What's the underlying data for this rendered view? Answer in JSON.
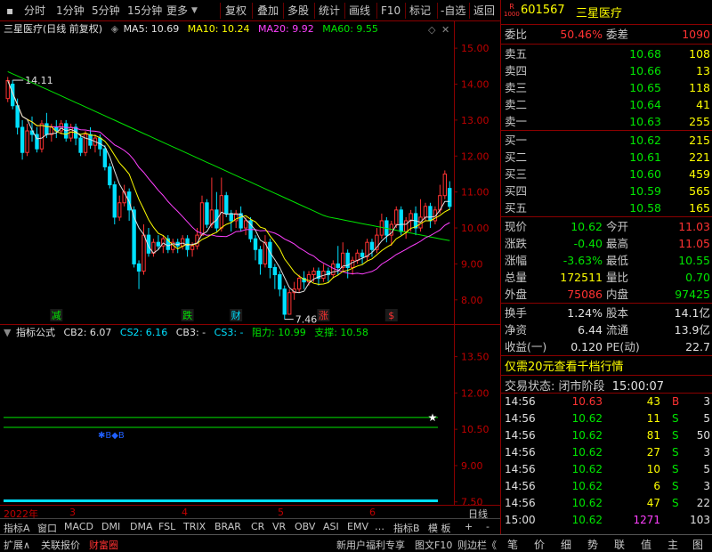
{
  "toolbar": {
    "period_buttons": [
      "分时",
      "1分钟",
      "5分钟",
      "15分钟",
      "更多"
    ],
    "action_buttons": [
      "复权",
      "叠加",
      "多股",
      "统计",
      "画线",
      "F10",
      "标记",
      "-自选",
      "返回"
    ]
  },
  "chart_title": {
    "name": "三星医疗",
    "mode": "(日线 前复权)",
    "ma5": "MA5: 10.69",
    "ma10": "MA10: 10.24",
    "ma20": "MA20: 9.92",
    "ma60": "MA60: 9.55"
  },
  "colors": {
    "up": "#ff3232",
    "down": "#00e0ff",
    "ma5": "#e0e0e0",
    "ma10": "#ffff00",
    "ma20": "#ff40ff",
    "ma60": "#00e600",
    "grid": "#8b0000"
  },
  "chart_data": {
    "type": "candlestick",
    "ylim": [
      7.5,
      15.3
    ],
    "yticks": [
      "15.00",
      "14.00",
      "13.00",
      "12.00",
      "11.00",
      "10.00",
      "9.00",
      "8.00"
    ],
    "high_label": "14.11",
    "low_label": "7.46",
    "candles": [
      [
        13.6,
        14.1,
        14.2,
        13.5
      ],
      [
        14.0,
        13.4,
        14.11,
        13.3
      ],
      [
        13.4,
        12.8,
        13.6,
        12.6
      ],
      [
        12.8,
        12.1,
        13.0,
        11.9
      ],
      [
        12.1,
        12.7,
        12.9,
        12.0
      ],
      [
        12.7,
        12.6,
        13.1,
        12.4
      ],
      [
        12.6,
        12.2,
        12.8,
        12.1
      ],
      [
        12.2,
        12.9,
        13.0,
        12.1
      ],
      [
        12.9,
        12.6,
        13.2,
        12.5
      ],
      [
        12.6,
        12.8,
        12.9,
        12.4
      ],
      [
        12.8,
        12.7,
        13.0,
        12.5
      ],
      [
        12.7,
        12.9,
        13.0,
        12.6
      ],
      [
        12.9,
        12.5,
        13.0,
        12.4
      ],
      [
        12.5,
        12.8,
        12.9,
        12.4
      ],
      [
        12.8,
        12.5,
        12.9,
        12.3
      ],
      [
        12.5,
        12.1,
        12.6,
        12.0
      ],
      [
        12.1,
        12.6,
        12.7,
        12.0
      ],
      [
        12.6,
        12.3,
        12.8,
        12.2
      ],
      [
        12.3,
        12.5,
        12.6,
        12.1
      ],
      [
        12.5,
        12.2,
        12.6,
        12.0
      ],
      [
        12.2,
        11.7,
        12.3,
        11.6
      ],
      [
        11.7,
        11.2,
        11.8,
        11.1
      ],
      [
        11.2,
        10.3,
        11.3,
        10.1
      ],
      [
        10.3,
        10.7,
        10.9,
        10.2
      ],
      [
        10.7,
        11.0,
        11.2,
        10.6
      ],
      [
        11.0,
        10.5,
        11.1,
        10.2
      ],
      [
        10.5,
        9.0,
        10.6,
        8.9
      ],
      [
        9.0,
        8.8,
        9.1,
        8.3
      ],
      [
        8.8,
        9.8,
        10.1,
        8.7
      ],
      [
        9.8,
        9.3,
        10.0,
        9.2
      ],
      [
        9.3,
        9.6,
        9.7,
        9.2
      ],
      [
        9.6,
        9.5,
        9.8,
        9.4
      ],
      [
        9.5,
        9.7,
        9.8,
        9.3
      ],
      [
        9.7,
        9.4,
        9.8,
        9.3
      ],
      [
        9.4,
        9.6,
        9.7,
        9.3
      ],
      [
        9.6,
        9.5,
        9.7,
        9.3
      ],
      [
        9.5,
        9.7,
        9.8,
        9.4
      ],
      [
        9.7,
        9.4,
        9.8,
        9.2
      ],
      [
        9.4,
        9.5,
        9.6,
        9.2
      ],
      [
        9.5,
        9.8,
        10.0,
        9.4
      ],
      [
        9.8,
        10.7,
        10.9,
        9.8
      ],
      [
        10.7,
        10.1,
        10.8,
        10.0
      ],
      [
        10.1,
        10.5,
        11.4,
        10.0
      ],
      [
        10.5,
        10.0,
        11.0,
        9.9
      ],
      [
        10.0,
        10.9,
        11.4,
        9.9
      ],
      [
        10.9,
        10.4,
        11.0,
        10.3
      ],
      [
        10.4,
        10.2,
        10.5,
        9.9
      ],
      [
        10.2,
        10.4,
        10.5,
        10.0
      ],
      [
        10.4,
        10.0,
        10.6,
        9.9
      ],
      [
        10.0,
        10.2,
        10.3,
        9.8
      ],
      [
        10.2,
        9.7,
        10.3,
        9.6
      ],
      [
        9.7,
        9.4,
        9.8,
        9.1
      ],
      [
        9.4,
        9.0,
        9.5,
        8.7
      ],
      [
        9.0,
        9.6,
        9.8,
        8.9
      ],
      [
        9.6,
        8.9,
        9.7,
        8.6
      ],
      [
        8.9,
        8.7,
        9.0,
        8.3
      ],
      [
        8.7,
        8.3,
        8.8,
        8.1
      ],
      [
        8.3,
        7.6,
        8.4,
        7.46
      ],
      [
        7.6,
        8.2,
        8.3,
        7.6
      ],
      [
        8.2,
        8.3,
        8.5,
        8.0
      ],
      [
        8.3,
        8.6,
        8.7,
        8.2
      ],
      [
        8.6,
        8.5,
        8.8,
        8.3
      ],
      [
        8.5,
        8.7,
        8.8,
        8.4
      ],
      [
        8.7,
        8.8,
        8.9,
        8.5
      ],
      [
        8.8,
        8.6,
        8.9,
        8.4
      ],
      [
        8.6,
        8.8,
        9.0,
        8.5
      ],
      [
        8.8,
        8.7,
        8.9,
        8.5
      ],
      [
        8.7,
        9.0,
        9.1,
        8.6
      ],
      [
        9.0,
        8.9,
        9.5,
        8.7
      ],
      [
        8.9,
        9.3,
        9.6,
        8.8
      ],
      [
        9.3,
        8.9,
        9.4,
        8.6
      ],
      [
        8.9,
        9.1,
        9.2,
        8.7
      ],
      [
        9.1,
        9.3,
        9.4,
        9.0
      ],
      [
        9.3,
        9.2,
        9.4,
        9.0
      ],
      [
        9.2,
        9.6,
        9.7,
        9.1
      ],
      [
        9.6,
        9.4,
        9.7,
        9.2
      ],
      [
        9.4,
        9.8,
        10.0,
        9.3
      ],
      [
        9.8,
        10.2,
        10.4,
        9.7
      ],
      [
        10.2,
        9.8,
        10.3,
        9.6
      ],
      [
        9.8,
        10.1,
        10.2,
        9.5
      ],
      [
        10.1,
        10.5,
        10.6,
        10.0
      ],
      [
        10.5,
        9.9,
        10.6,
        9.8
      ],
      [
        9.9,
        10.2,
        10.3,
        9.7
      ],
      [
        10.2,
        10.4,
        10.5,
        9.9
      ],
      [
        10.4,
        10.0,
        10.6,
        9.8
      ],
      [
        10.0,
        10.3,
        10.8,
        9.9
      ],
      [
        10.3,
        10.6,
        10.7,
        10.2
      ],
      [
        10.6,
        10.2,
        10.7,
        10.0
      ],
      [
        10.2,
        10.5,
        10.6,
        10.1
      ],
      [
        10.5,
        10.9,
        11.2,
        10.4
      ],
      [
        10.9,
        11.5,
        11.6,
        10.8
      ],
      [
        11.1,
        10.6,
        11.3,
        10.5
      ]
    ],
    "markers": [
      {
        "text": "减",
        "idx": 10,
        "color": "#00e600"
      },
      {
        "text": "跌",
        "idx": 37,
        "color": "#00e600"
      },
      {
        "text": "财",
        "idx": 47,
        "color": "#00e0ff"
      },
      {
        "text": "涨",
        "idx": 65,
        "color": "#ff3232"
      },
      {
        "text": "$",
        "idx": 79,
        "color": "#ff3232"
      }
    ]
  },
  "sub_chart": {
    "title": "指标公式",
    "cb2": "CB2: 6.07",
    "cs2": "CS2: 6.16",
    "cb3": "CB3: -",
    "cs3": "CS3: -",
    "resist": "阻力: 10.99",
    "support": "支撑: 10.58",
    "ylim": [
      7.6,
      14.0
    ],
    "yticks": [
      "13.50",
      "12.00",
      "10.50",
      "9.00",
      "7.50"
    ],
    "resist_val": 10.99,
    "support_val": 10.58,
    "marker_label": "✱B◆B"
  },
  "date_axis": {
    "labels": [
      "2022年",
      "3",
      "4",
      "5",
      "6",
      "日线"
    ]
  },
  "indicator_tabs": [
    "指标A",
    "窗口",
    "MACD",
    "DMI",
    "DMA",
    "FSL",
    "TRIX",
    "BRAR",
    "CR",
    "VR",
    "OBV",
    "ASI",
    "EMV",
    "…",
    "指标B",
    "模 板",
    "+",
    "-"
  ],
  "bottom_bar": {
    "left": [
      "扩展∧",
      "关联报价",
      "财富圈"
    ],
    "right": [
      "新用户福利专享",
      "图文F10",
      "则边栏《"
    ]
  },
  "quote": {
    "tag_top": "R",
    "tag_bottom": "1000",
    "code": "601567",
    "name": "三星医疗",
    "weibi_label": "委比",
    "weibi": "50.46%",
    "weicha_label": "委差",
    "weicha": "1090",
    "asks": [
      {
        "label": "卖五",
        "price": "10.68",
        "vol": "108"
      },
      {
        "label": "卖四",
        "price": "10.66",
        "vol": "13"
      },
      {
        "label": "卖三",
        "price": "10.65",
        "vol": "118"
      },
      {
        "label": "卖二",
        "price": "10.64",
        "vol": "41"
      },
      {
        "label": "卖一",
        "price": "10.63",
        "vol": "255"
      }
    ],
    "bids": [
      {
        "label": "买一",
        "price": "10.62",
        "vol": "215"
      },
      {
        "label": "买二",
        "price": "10.61",
        "vol": "221"
      },
      {
        "label": "买三",
        "price": "10.60",
        "vol": "459"
      },
      {
        "label": "买四",
        "price": "10.59",
        "vol": "565"
      },
      {
        "label": "买五",
        "price": "10.58",
        "vol": "165"
      }
    ],
    "stats": [
      {
        "l1": "现价",
        "v1": "10.62",
        "c1": "green",
        "l2": "今开",
        "v2": "11.03",
        "c2": "red"
      },
      {
        "l1": "涨跌",
        "v1": "-0.40",
        "c1": "green",
        "l2": "最高",
        "v2": "11.05",
        "c2": "red"
      },
      {
        "l1": "涨幅",
        "v1": "-3.63%",
        "c1": "green",
        "l2": "最低",
        "v2": "10.55",
        "c2": "green"
      },
      {
        "l1": "总量",
        "v1": "172511",
        "c1": "yellow",
        "l2": "量比",
        "v2": "0.70",
        "c2": "green"
      },
      {
        "l1": "外盘",
        "v1": "75086",
        "c1": "red",
        "l2": "内盘",
        "v2": "97425",
        "c2": "green"
      }
    ],
    "fin": [
      {
        "l1": "换手",
        "v1": "1.24%",
        "l2": "股本",
        "v2": "14.1亿"
      },
      {
        "l1": "净资",
        "v1": "6.44",
        "l2": "流通",
        "v2": "13.9亿"
      },
      {
        "l1": "收益(一)",
        "v1": "0.120",
        "l2": "PE(动)",
        "v2": "22.7"
      }
    ],
    "promo": "仅需20元查看千档行情",
    "status_label": "交易状态:",
    "status": "闭市阶段",
    "status_time": "15:00:07"
  },
  "ticks": [
    {
      "t": "14:56",
      "p": "10.63",
      "pc": "red",
      "v": "43",
      "vc": "yellow",
      "f": "B",
      "fc": "red",
      "n": "3"
    },
    {
      "t": "14:56",
      "p": "10.62",
      "pc": "green",
      "v": "11",
      "vc": "yellow",
      "f": "S",
      "fc": "green",
      "n": "5"
    },
    {
      "t": "14:56",
      "p": "10.62",
      "pc": "green",
      "v": "81",
      "vc": "yellow",
      "f": "S",
      "fc": "green",
      "n": "50"
    },
    {
      "t": "14:56",
      "p": "10.62",
      "pc": "green",
      "v": "27",
      "vc": "yellow",
      "f": "S",
      "fc": "green",
      "n": "3"
    },
    {
      "t": "14:56",
      "p": "10.62",
      "pc": "green",
      "v": "10",
      "vc": "yellow",
      "f": "S",
      "fc": "green",
      "n": "5"
    },
    {
      "t": "14:56",
      "p": "10.62",
      "pc": "green",
      "v": "6",
      "vc": "yellow",
      "f": "S",
      "fc": "green",
      "n": "3"
    },
    {
      "t": "14:56",
      "p": "10.62",
      "pc": "green",
      "v": "47",
      "vc": "yellow",
      "f": "S",
      "fc": "green",
      "n": "22"
    },
    {
      "t": "15:00",
      "p": "10.62",
      "pc": "green",
      "v": "1271",
      "vc": "mag",
      "f": "",
      "fc": "green",
      "n": "103"
    }
  ],
  "right_tabs": [
    "笔",
    "价",
    "细",
    "势",
    "联",
    "值",
    "主",
    "图"
  ]
}
